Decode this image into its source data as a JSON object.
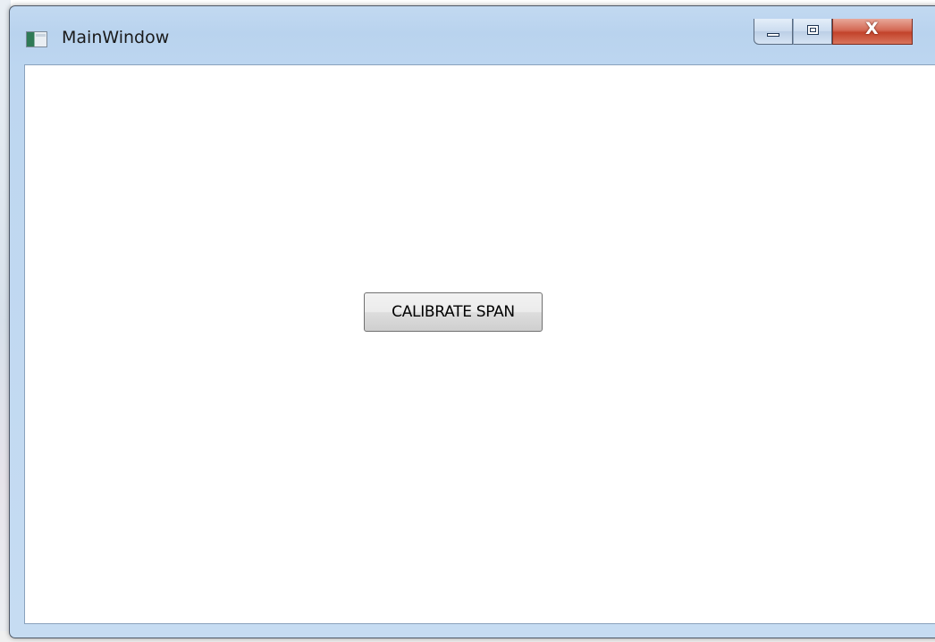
{
  "window": {
    "title": "MainWindow",
    "app_icon": "window-app-icon",
    "caption_buttons": {
      "minimize_icon": "minimize-icon",
      "maximize_icon": "maximize-icon",
      "close_glyph": "X"
    }
  },
  "main": {
    "calibrate_button_label": "CALIBRATE SPAN"
  },
  "colors": {
    "title_bar": "#bdd6f0",
    "close_button": "#c2432b",
    "client_background": "#ffffff"
  }
}
